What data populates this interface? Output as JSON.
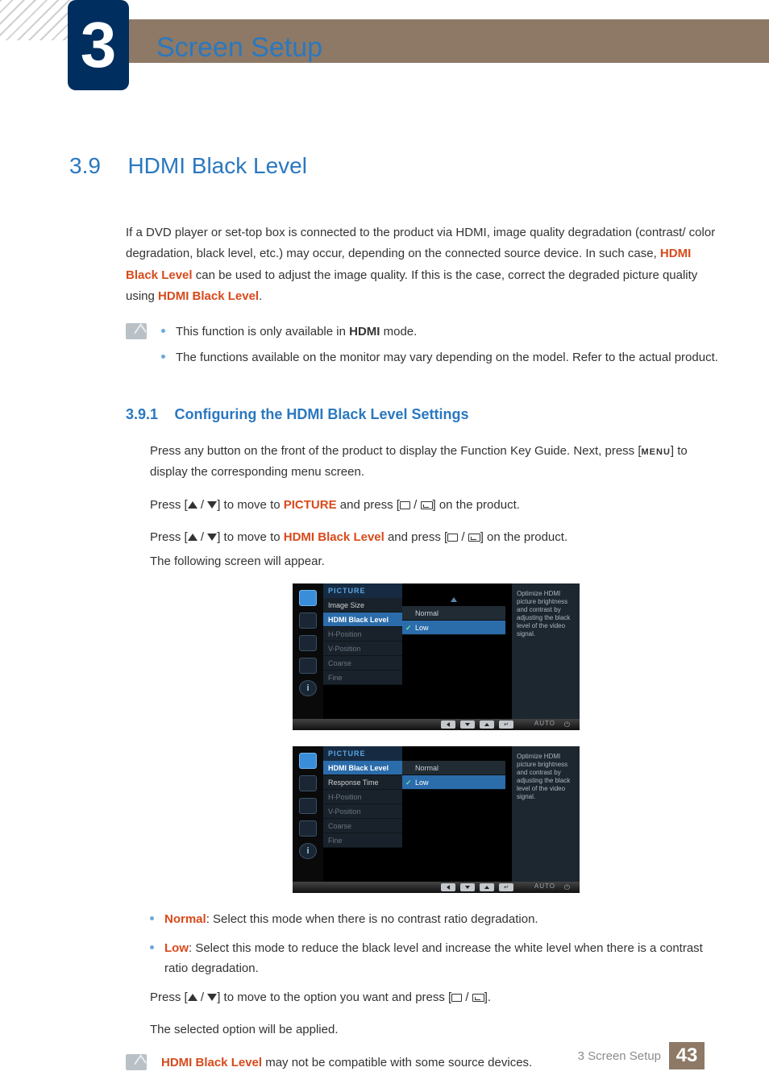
{
  "chapter": {
    "number": "3",
    "title": "Screen Setup"
  },
  "section": {
    "number": "3.9",
    "title": "HDMI Black Level"
  },
  "intro": {
    "p1_a": "If a DVD player or set-top box is connected to the product via HDMI, image quality degradation (contrast/ color degradation, black level, etc.) may occur, depending on the connected source device. In such case, ",
    "kw1": "HDMI Black Level",
    "p1_b": " can be used to adjust the image quality. If this is the case, correct the degraded picture quality using ",
    "kw2": "HDMI Black Level",
    "p1_c": "."
  },
  "notes1": {
    "b1_a": "This function is only available in ",
    "b1_kw": "HDMI",
    "b1_b": " mode.",
    "b2": "The functions available on the monitor may vary depending on the model. Refer to the actual product."
  },
  "subsection": {
    "number": "3.9.1",
    "title": "Configuring the HDMI Black Level Settings"
  },
  "steps": {
    "s1_a": "Press any button on the front of the product to display the Function Key Guide. Next, press [",
    "s1_menu": "MENU",
    "s1_b": "] to display the corresponding menu screen.",
    "s2_a": "Press [",
    "s2_b": "] to move to ",
    "s2_kw": "PICTURE",
    "s2_c": " and press [",
    "s2_d": "] on the product.",
    "s3_a": "Press [",
    "s3_b": "] to move to ",
    "s3_kw": "HDMI Black Level",
    "s3_c": " and press [",
    "s3_d": "] on the product.",
    "s3_tail": "The following screen will appear."
  },
  "osd1": {
    "header": "PICTURE",
    "items": [
      "Image Size",
      "HDMI Black Level",
      "H-Position",
      "V-Position",
      "Coarse",
      "Fine"
    ],
    "selected": "HDMI Black Level",
    "enabled": [
      "Image Size",
      "HDMI Black Level"
    ],
    "options": [
      "Normal",
      "Low"
    ],
    "opt_selected": "Low",
    "help": "Optimize HDMI picture brightness and contrast by adjusting the black level of the video signal.",
    "auto": "AUTO"
  },
  "osd2": {
    "header": "PICTURE",
    "items": [
      "HDMI Black Level",
      "Response Time",
      "H-Position",
      "V-Position",
      "Coarse",
      "Fine"
    ],
    "selected": "HDMI Black Level",
    "enabled": [
      "HDMI Black Level",
      "Response Time"
    ],
    "options": [
      "Normal",
      "Low"
    ],
    "opt_selected": "Low",
    "help": "Optimize HDMI picture brightness and contrast by adjusting the black level of the video signal.",
    "auto": "AUTO"
  },
  "option_bullets": {
    "b1_kw": "Normal",
    "b1_txt": ": Select this mode when there is no contrast ratio degradation.",
    "b2_kw": "Low",
    "b2_txt": ": Select this mode to reduce the black level and increase the white level when there is a contrast ratio degradation."
  },
  "steps_after": {
    "s4_a": "Press [",
    "s4_b": "] to move to the option you want and press [",
    "s4_c": "].",
    "s5": "The selected option will be applied."
  },
  "note2": {
    "kw": "HDMI Black Level",
    "txt": " may not be compatible with some source devices."
  },
  "footer": {
    "label": "3 Screen Setup",
    "page": "43"
  }
}
